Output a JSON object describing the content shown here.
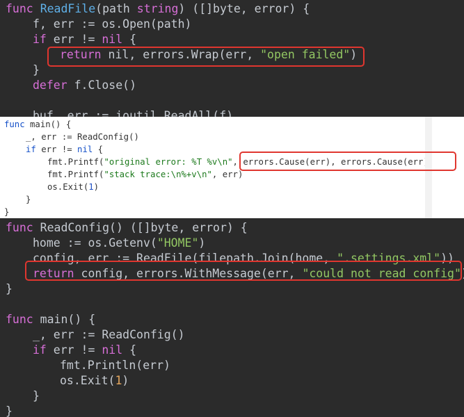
{
  "back_top": {
    "lines": [
      {
        "i": 0,
        "tokens": [
          [
            "kw",
            "func"
          ],
          [
            "",
            " "
          ],
          [
            "fn",
            "ReadFile"
          ],
          [
            "",
            "(path "
          ],
          [
            "kw",
            "string"
          ],
          [
            "",
            ") ([]byte, error) {"
          ]
        ]
      },
      {
        "i": 1,
        "tokens": [
          [
            "",
            "f, err := os.Open(path)"
          ]
        ]
      },
      {
        "i": 1,
        "tokens": [
          [
            "kw",
            "if"
          ],
          [
            "",
            " err != "
          ],
          [
            "kw",
            "nil"
          ],
          [
            "",
            " {"
          ]
        ]
      },
      {
        "i": 2,
        "tokens": [
          [
            "kw",
            "return"
          ],
          [
            "",
            " nil, errors.Wrap(err, "
          ],
          [
            "str",
            "\"open failed\""
          ],
          [
            "",
            ")"
          ]
        ]
      },
      {
        "i": 1,
        "tokens": [
          [
            "",
            "}"
          ]
        ]
      },
      {
        "i": 1,
        "tokens": [
          [
            "kw",
            "defer"
          ],
          [
            "",
            " f.Close()"
          ]
        ]
      },
      {
        "i": 0,
        "tokens": [
          [
            "",
            ""
          ]
        ]
      },
      {
        "i": 1,
        "tokens": [
          [
            "",
            "buf, err := ioutil.ReadAll(f)"
          ]
        ]
      }
    ]
  },
  "front": {
    "lines": [
      {
        "i": 0,
        "tokens": [
          [
            "kw",
            "func"
          ],
          [
            "",
            " main() {"
          ]
        ]
      },
      {
        "i": 1,
        "tokens": [
          [
            "",
            "_, err := ReadConfig()"
          ]
        ]
      },
      {
        "i": 1,
        "tokens": [
          [
            "kw",
            "if"
          ],
          [
            "",
            " err != "
          ],
          [
            "kw",
            "nil"
          ],
          [
            "",
            " {"
          ]
        ]
      },
      {
        "i": 2,
        "tokens": [
          [
            "",
            "fmt.Printf("
          ],
          [
            "str",
            "\"original error: %T %v\\n\""
          ],
          [
            "",
            ", errors.Cause(err), errors.Cause(err))"
          ]
        ]
      },
      {
        "i": 2,
        "tokens": [
          [
            "",
            "fmt.Printf("
          ],
          [
            "str",
            "\"stack trace:\\n%+v\\n\""
          ],
          [
            "",
            ", err)"
          ]
        ]
      },
      {
        "i": 2,
        "tokens": [
          [
            "",
            "os.Exit("
          ],
          [
            "num",
            "1"
          ],
          [
            "",
            ")"
          ]
        ]
      },
      {
        "i": 1,
        "tokens": [
          [
            "",
            "}"
          ]
        ]
      },
      {
        "i": 0,
        "tokens": [
          [
            "",
            "}"
          ]
        ]
      }
    ]
  },
  "back_bottom": {
    "lines": [
      {
        "i": 0,
        "tokens": [
          [
            "kw",
            "func"
          ],
          [
            "",
            " ReadConfig() ([]byte, error) {"
          ]
        ]
      },
      {
        "i": 1,
        "tokens": [
          [
            "",
            "home := os.Getenv("
          ],
          [
            "str",
            "\"HOME\""
          ],
          [
            "",
            ")"
          ]
        ]
      },
      {
        "i": 1,
        "tokens": [
          [
            "",
            "config, err := ReadFile(filepath.Join(home, "
          ],
          [
            "str",
            "\".settings.xml\""
          ],
          [
            "",
            "))"
          ]
        ]
      },
      {
        "i": 1,
        "tokens": [
          [
            "kw",
            "return"
          ],
          [
            "",
            " config, errors.WithMessage(err, "
          ],
          [
            "str",
            "\"could not read config\""
          ],
          [
            "",
            ")"
          ]
        ]
      },
      {
        "i": 0,
        "tokens": [
          [
            "",
            "}"
          ]
        ]
      },
      {
        "i": 0,
        "tokens": [
          [
            "",
            ""
          ]
        ]
      },
      {
        "i": 0,
        "tokens": [
          [
            "kw",
            "func"
          ],
          [
            "",
            " main() {"
          ]
        ]
      },
      {
        "i": 1,
        "tokens": [
          [
            "",
            "_, err := ReadConfig()"
          ]
        ]
      },
      {
        "i": 1,
        "tokens": [
          [
            "kw",
            "if"
          ],
          [
            "",
            " err != "
          ],
          [
            "kw",
            "nil"
          ],
          [
            "",
            " {"
          ]
        ]
      },
      {
        "i": 2,
        "tokens": [
          [
            "",
            "fmt.Println(err)"
          ]
        ]
      },
      {
        "i": 2,
        "tokens": [
          [
            "",
            "os.Exit("
          ],
          [
            "num",
            "1"
          ],
          [
            "",
            ")"
          ]
        ]
      },
      {
        "i": 1,
        "tokens": [
          [
            "",
            "}"
          ]
        ]
      },
      {
        "i": 0,
        "tokens": [
          [
            "",
            "}"
          ]
        ]
      }
    ]
  }
}
